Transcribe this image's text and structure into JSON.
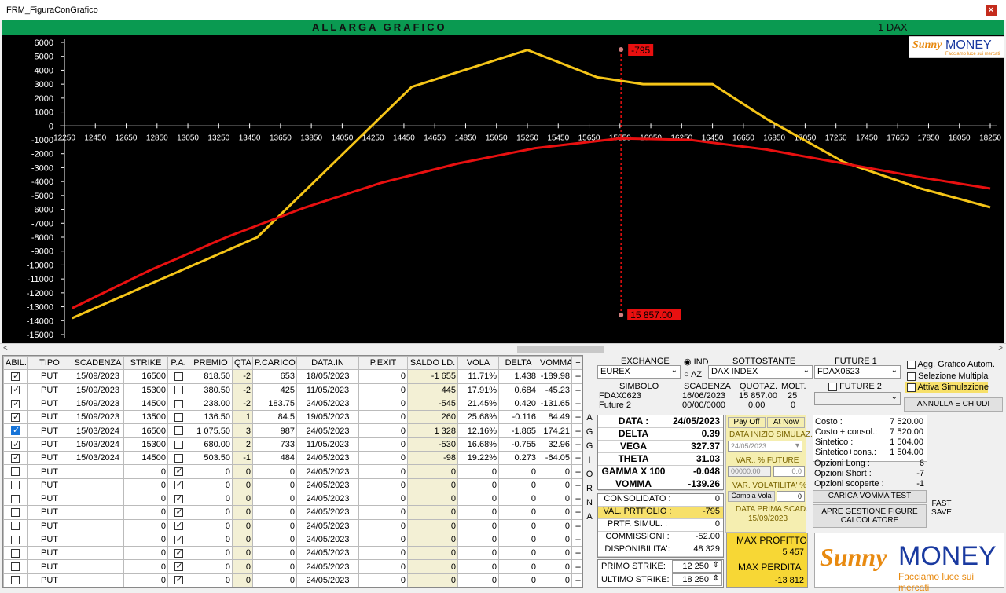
{
  "window": {
    "title": "FRM_FiguraConGrafico",
    "close": "×"
  },
  "header": {
    "label": "ALLARGA GRAFICO",
    "count": "1 DAX"
  },
  "logo": {
    "brand1": "Sunny",
    "brand2": "MONEY",
    "tagline": "Facciamo luce sui mercati"
  },
  "chart_data": {
    "type": "line",
    "x_ticks": [
      12250,
      12450,
      12650,
      12850,
      13050,
      13250,
      13450,
      13650,
      13850,
      14050,
      14250,
      14450,
      14650,
      14850,
      15050,
      15250,
      15450,
      15650,
      15850,
      16050,
      16250,
      16450,
      16650,
      16850,
      17050,
      17250,
      17450,
      17650,
      17850,
      18050,
      18250
    ],
    "y_ticks": [
      6000,
      5000,
      4000,
      3000,
      2000,
      1000,
      0,
      -1000,
      -2000,
      -3000,
      -4000,
      -5000,
      -6000,
      -7000,
      -8000,
      -9000,
      -10000,
      -11000,
      -12000,
      -13000,
      -14000,
      -15000
    ],
    "xlim": [
      12250,
      18250
    ],
    "ylim": [
      -15000,
      6000
    ],
    "series": [
      {
        "color": "#f5c518",
        "x": [
          12300,
          13500,
          14500,
          15250,
          15700,
          16000,
          16450,
          16800,
          17300,
          17800,
          18250
        ],
        "y": [
          -13812,
          -8000,
          2800,
          5457,
          3500,
          3000,
          3000,
          500,
          -2600,
          -4500,
          -5850
        ]
      },
      {
        "color": "#e81010",
        "x": [
          12300,
          12800,
          13300,
          13800,
          14300,
          14800,
          15300,
          15850,
          16300,
          16800,
          17300,
          17800,
          18250
        ],
        "y": [
          -13100,
          -10400,
          -8000,
          -5900,
          -4100,
          -2700,
          -1600,
          -900,
          -1000,
          -1700,
          -2700,
          -3700,
          -4500
        ]
      }
    ],
    "marker": {
      "x": 15857,
      "top_label": "-795",
      "bottom_label": "15 857.00"
    }
  },
  "grid": {
    "columns": [
      "ABIL.",
      "TIPO",
      "SCADENZA",
      "STRIKE",
      "P.A.",
      "PREMIO",
      "QTA",
      "P.CARICO",
      "DATA.IN",
      "P.EXIT",
      "SALDO LD.",
      "VOLA",
      "DELTA",
      "VOMMA",
      "+"
    ],
    "rows": [
      {
        "abil": true,
        "sel": false,
        "tipo": "PUT",
        "scad": "15/09/2023",
        "strike": "16500",
        "pa": false,
        "premio": "818.50",
        "qta": "-2",
        "pcar": "653",
        "datain": "18/05/2023",
        "pexit": "0",
        "saldo": "-1 655",
        "vola": "11.71%",
        "delta": "1.438",
        "vomma": "-189.98",
        "btn": "--"
      },
      {
        "abil": true,
        "sel": false,
        "tipo": "PUT",
        "scad": "15/09/2023",
        "strike": "15300",
        "pa": false,
        "premio": "380.50",
        "qta": "-2",
        "pcar": "425",
        "datain": "11/05/2023",
        "pexit": "0",
        "saldo": "445",
        "vola": "17.91%",
        "delta": "0.684",
        "vomma": "-45.23",
        "btn": "--"
      },
      {
        "abil": true,
        "sel": false,
        "tipo": "PUT",
        "scad": "15/09/2023",
        "strike": "14500",
        "pa": false,
        "premio": "238.00",
        "qta": "-2",
        "pcar": "183.75",
        "datain": "24/05/2023",
        "pexit": "0",
        "saldo": "-545",
        "vola": "21.45%",
        "delta": "0.420",
        "vomma": "-131.65",
        "btn": "--"
      },
      {
        "abil": true,
        "sel": false,
        "tipo": "PUT",
        "scad": "15/09/2023",
        "strike": "13500",
        "pa": false,
        "premio": "136.50",
        "qta": "1",
        "pcar": "84.5",
        "datain": "19/05/2023",
        "pexit": "0",
        "saldo": "260",
        "vola": "25.68%",
        "delta": "-0.116",
        "vomma": "84.49",
        "btn": "--"
      },
      {
        "abil": true,
        "sel": true,
        "tipo": "PUT",
        "scad": "15/03/2024",
        "strike": "16500",
        "pa": false,
        "premio": "1 075.50",
        "qta": "3",
        "pcar": "987",
        "datain": "24/05/2023",
        "pexit": "0",
        "saldo": "1 328",
        "vola": "12.16%",
        "delta": "-1.865",
        "vomma": "174.21",
        "btn": "--"
      },
      {
        "abil": true,
        "sel": false,
        "tipo": "PUT",
        "scad": "15/03/2024",
        "strike": "15300",
        "pa": false,
        "premio": "680.00",
        "qta": "2",
        "pcar": "733",
        "datain": "11/05/2023",
        "pexit": "0",
        "saldo": "-530",
        "vola": "16.68%",
        "delta": "-0.755",
        "vomma": "32.96",
        "btn": "--"
      },
      {
        "abil": true,
        "sel": false,
        "tipo": "PUT",
        "scad": "15/03/2024",
        "strike": "14500",
        "pa": false,
        "premio": "503.50",
        "qta": "-1",
        "pcar": "484",
        "datain": "24/05/2023",
        "pexit": "0",
        "saldo": "-98",
        "vola": "19.22%",
        "delta": "0.273",
        "vomma": "-64.05",
        "btn": "--"
      },
      {
        "abil": false,
        "sel": false,
        "tipo": "PUT",
        "scad": "",
        "strike": "0",
        "pa": true,
        "premio": "0",
        "qta": "0",
        "pcar": "0",
        "datain": "24/05/2023",
        "pexit": "0",
        "saldo": "0",
        "vola": "0",
        "delta": "0",
        "vomma": "0",
        "btn": "--"
      },
      {
        "abil": false,
        "sel": false,
        "tipo": "PUT",
        "scad": "",
        "strike": "0",
        "pa": true,
        "premio": "0",
        "qta": "0",
        "pcar": "0",
        "datain": "24/05/2023",
        "pexit": "0",
        "saldo": "0",
        "vola": "0",
        "delta": "0",
        "vomma": "0",
        "btn": "--"
      },
      {
        "abil": false,
        "sel": false,
        "tipo": "PUT",
        "scad": "",
        "strike": "0",
        "pa": true,
        "premio": "0",
        "qta": "0",
        "pcar": "0",
        "datain": "24/05/2023",
        "pexit": "0",
        "saldo": "0",
        "vola": "0",
        "delta": "0",
        "vomma": "0",
        "btn": "--"
      },
      {
        "abil": false,
        "sel": false,
        "tipo": "PUT",
        "scad": "",
        "strike": "0",
        "pa": true,
        "premio": "0",
        "qta": "0",
        "pcar": "0",
        "datain": "24/05/2023",
        "pexit": "0",
        "saldo": "0",
        "vola": "0",
        "delta": "0",
        "vomma": "0",
        "btn": "--"
      },
      {
        "abil": false,
        "sel": false,
        "tipo": "PUT",
        "scad": "",
        "strike": "0",
        "pa": true,
        "premio": "0",
        "qta": "0",
        "pcar": "0",
        "datain": "24/05/2023",
        "pexit": "0",
        "saldo": "0",
        "vola": "0",
        "delta": "0",
        "vomma": "0",
        "btn": "--"
      },
      {
        "abil": false,
        "sel": false,
        "tipo": "PUT",
        "scad": "",
        "strike": "0",
        "pa": true,
        "premio": "0",
        "qta": "0",
        "pcar": "0",
        "datain": "24/05/2023",
        "pexit": "0",
        "saldo": "0",
        "vola": "0",
        "delta": "0",
        "vomma": "0",
        "btn": "--"
      },
      {
        "abil": false,
        "sel": false,
        "tipo": "PUT",
        "scad": "",
        "strike": "0",
        "pa": true,
        "premio": "0",
        "qta": "0",
        "pcar": "0",
        "datain": "24/05/2023",
        "pexit": "0",
        "saldo": "0",
        "vola": "0",
        "delta": "0",
        "vomma": "0",
        "btn": "--"
      },
      {
        "abil": false,
        "sel": false,
        "tipo": "PUT",
        "scad": "",
        "strike": "0",
        "pa": true,
        "premio": "0",
        "qta": "0",
        "pcar": "0",
        "datain": "24/05/2023",
        "pexit": "0",
        "saldo": "0",
        "vola": "0",
        "delta": "0",
        "vomma": "0",
        "btn": "--"
      },
      {
        "abil": false,
        "sel": false,
        "tipo": "PUT",
        "scad": "",
        "strike": "0",
        "pa": true,
        "premio": "0",
        "qta": "0",
        "pcar": "0",
        "datain": "24/05/2023",
        "pexit": "0",
        "saldo": "0",
        "vola": "0",
        "delta": "0",
        "vomma": "0",
        "btn": "--"
      }
    ]
  },
  "aggiorna": [
    "A",
    "G",
    "G",
    "I",
    "O",
    "R",
    "N",
    "A"
  ],
  "panel": {
    "exchange_label": "EXCHANGE",
    "exchange": "EUREX",
    "ind": "IND",
    "az": "AZ",
    "sottostante_label": "SOTTOSTANTE",
    "sottostante": "DAX INDEX",
    "future1_label": "FUTURE 1",
    "future1": "FDAX0623",
    "future2_label": "FUTURE 2",
    "simbolo_label": "SIMBOLO",
    "scadenza_label": "SCADENZA",
    "quotaz_label": "QUOTAZ.",
    "molt_label": "MOLT.",
    "r1": {
      "simbolo": "FDAX0623",
      "scad": "16/06/2023",
      "quot": "15 857.00",
      "molt": "25"
    },
    "r2": {
      "simbolo": "Future 2",
      "scad": "00/00/0000",
      "quot": "0.00",
      "molt": "0"
    },
    "greeks": [
      {
        "k": "DATA :",
        "v": "24/05/2023"
      },
      {
        "k": "DELTA",
        "v": "0.39"
      },
      {
        "k": "VEGA",
        "v": "327.37"
      },
      {
        "k": "THETA",
        "v": "31.03"
      },
      {
        "k": "GAMMA X 100",
        "v": "-0.048"
      },
      {
        "k": "VOMMA",
        "v": "-139.26"
      }
    ],
    "payoff": "Pay Off",
    "atnow": "At Now",
    "data_inizio_label": "DATA INIZIO SIMULAZ.",
    "data_inizio": "24/05/2023",
    "var_future_label": "VAR.. % FUTURE",
    "var_future_a": "00000.00",
    "var_future_b": "0.0",
    "var_vol_label": "VAR. VOLATILITA' %",
    "cambia_vola": "Cambia Vola",
    "cambia_vola_v": "0",
    "data_prima_label": "DATA PRIMA SCAD.",
    "data_prima": "15/09/2023",
    "summary": [
      {
        "k": "CONSOLIDATO :",
        "v": "0"
      },
      {
        "k": "VAL. PRTFOLIO :",
        "v": "-795"
      },
      {
        "k": "PRTF. SIMUL. :",
        "v": "0"
      },
      {
        "k": "COMMISSIONI :",
        "v": "-52.00"
      },
      {
        "k": "DISPONIBILITA':",
        "v": "48 329"
      }
    ],
    "primo_label": "PRIMO STRIKE:",
    "primo": "12 250",
    "ultimo_label": "ULTIMO STRIKE:",
    "ultimo": "18 250",
    "maxp_label": "MAX PROFITTO",
    "maxp": "5 457",
    "maxl_label": "MAX PERDITA",
    "maxl": "-13 812",
    "costs": [
      {
        "k": "Costo :",
        "v": "7 520.00"
      },
      {
        "k": "Costo + consol.:",
        "v": "7 520.00"
      },
      {
        "k": "Sintetico :",
        "v": "1 504.00"
      },
      {
        "k": "Sintetico+cons.:",
        "v": "1 504.00"
      }
    ],
    "opts": [
      {
        "k": "Opzioni Long :",
        "v": "6"
      },
      {
        "k": "Opzioni Short :",
        "v": "-7"
      },
      {
        "k": "Opzioni scoperte :",
        "v": "-1"
      }
    ],
    "carica": "CARICA VOMMA TEST",
    "apre": "APRE GESTIONE FIGURE CALCOLATORE",
    "fast": "FAST SAVE"
  },
  "right": {
    "agg": "Agg. Grafico Autom.",
    "selm": "Selezione Multipla",
    "attiva": "Attiva Simulazione",
    "annulla": "ANNULLA E CHIUDI"
  }
}
